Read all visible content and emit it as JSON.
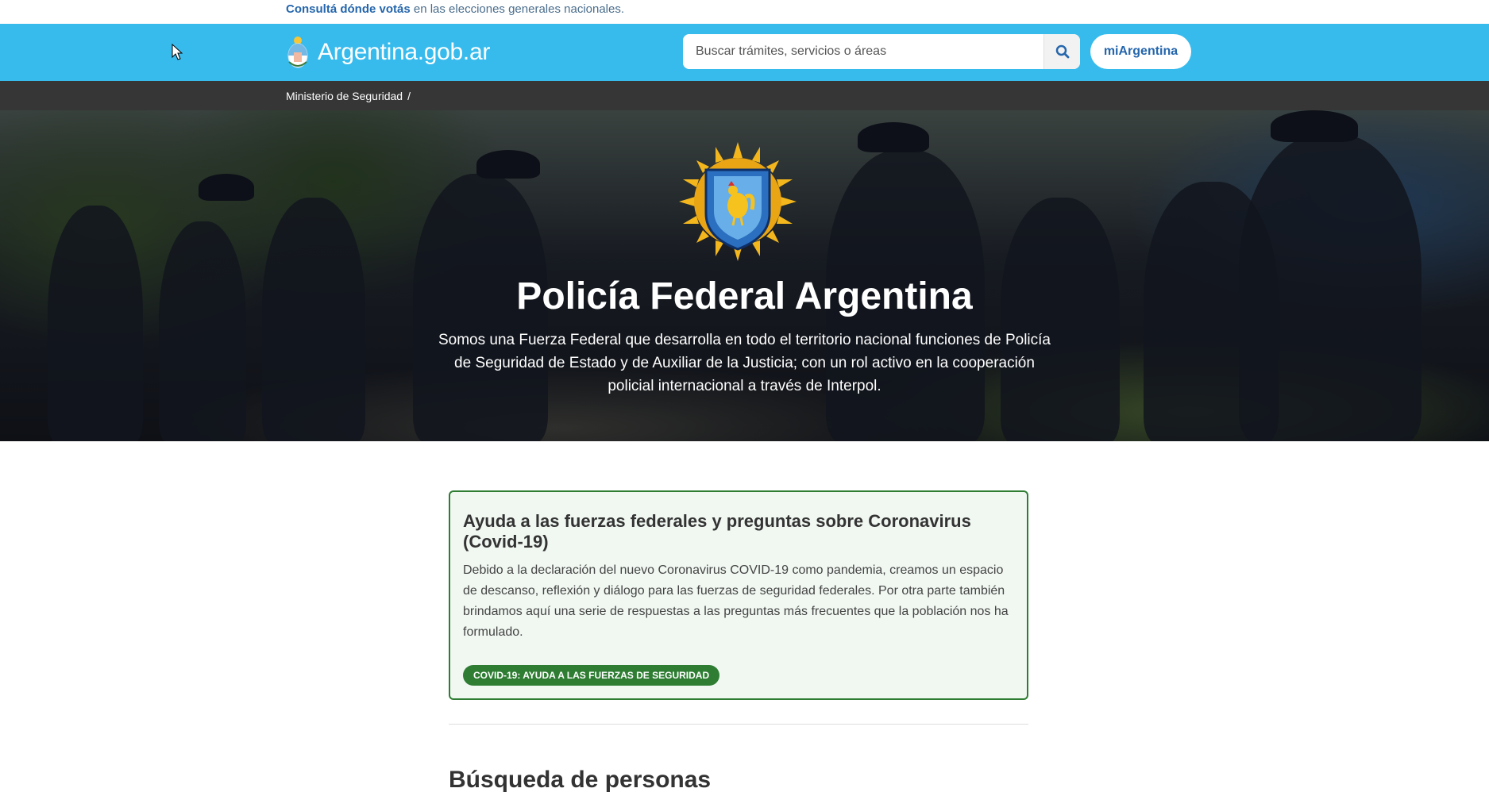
{
  "top_notice": {
    "link": "Consultá dónde votás",
    "rest": " en las elecciones generales nacionales."
  },
  "header": {
    "brand": "Argentina.gob.ar",
    "search_placeholder": "Buscar trámites, servicios o áreas",
    "mi_argentina": "miArgentina",
    "colors": {
      "bar": "#37bbed",
      "link": "#2566ac"
    }
  },
  "breadcrumb": {
    "item": "Ministerio de Seguridad",
    "separator": "/"
  },
  "hero": {
    "title": "Policía Federal Argentina",
    "description": "Somos una Fuerza Federal que desarrolla en todo el territorio nacional funciones de Policía de Seguridad de Estado y de Auxiliar de la Justicia; con un rol activo en la cooperación policial internacional a través de Interpol.",
    "badge_icon": "policia-federal-emblem-icon"
  },
  "covid_card": {
    "title": "Ayuda a las fuerzas federales y preguntas sobre Coronavirus (Covid-19)",
    "body": "Debido a la declaración del nuevo Coronavirus COVID-19 como pandemia, creamos un espacio de descanso, reflexión y diálogo para las fuerzas de seguridad federales. Por otra parte también brindamos aquí una serie de respuestas a las preguntas más frecuentes que la población nos ha formulado.",
    "button": "COVID-19: AYUDA A LAS FUERZAS DE SEGURIDAD",
    "accent": "#2e7d33"
  },
  "sections": {
    "busqueda_title": "Búsqueda de personas"
  }
}
